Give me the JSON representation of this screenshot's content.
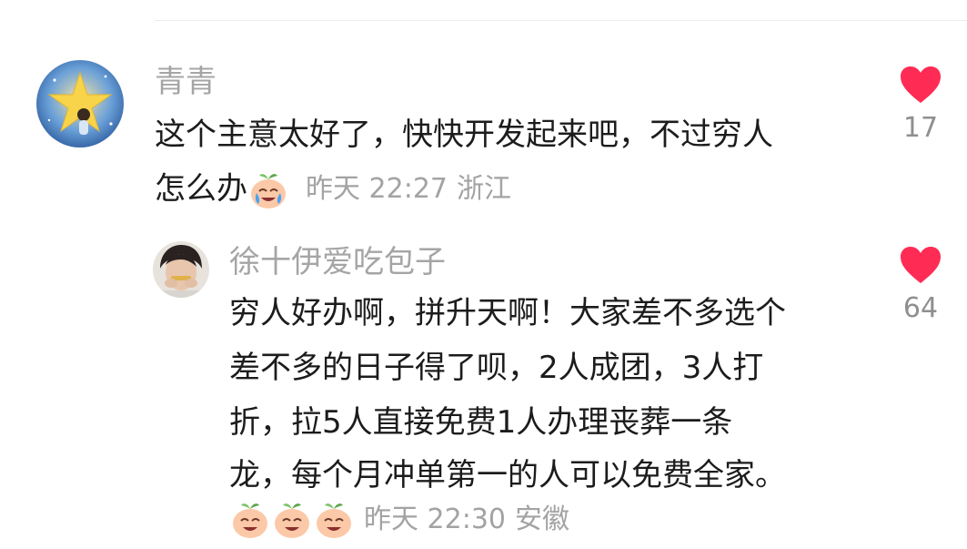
{
  "comments": [
    {
      "username": "青青",
      "lines": [
        "这个主意太好了，快快开发起来吧，不过穷人",
        "怎么办"
      ],
      "emoji": "crying-laughing-face",
      "time": "昨天 22:27",
      "location": "浙江",
      "likes": "17"
    },
    {
      "username": "徐十伊爱吃包子",
      "lines": [
        "穷人好办啊，拼升天啊！大家差不多选个",
        "差不多的日子得了呗，2人成团，3人打",
        "折，拉5人直接免费1人办理丧葬一条",
        "龙，每个月冲单第一的人可以免费全家。"
      ],
      "emojis": [
        "crying-laughing-face",
        "crying-laughing-face",
        "crying-laughing-face"
      ],
      "time": "昨天 22:30",
      "location": "安徽",
      "likes": "64"
    }
  ],
  "colors": {
    "username": "#a5a5a5",
    "text": "#1c1c1c",
    "meta": "#a3a3a3",
    "heart": "#fe2c55"
  },
  "icons": {
    "like": "heart-icon",
    "emoji": "crying-laughing-face"
  }
}
